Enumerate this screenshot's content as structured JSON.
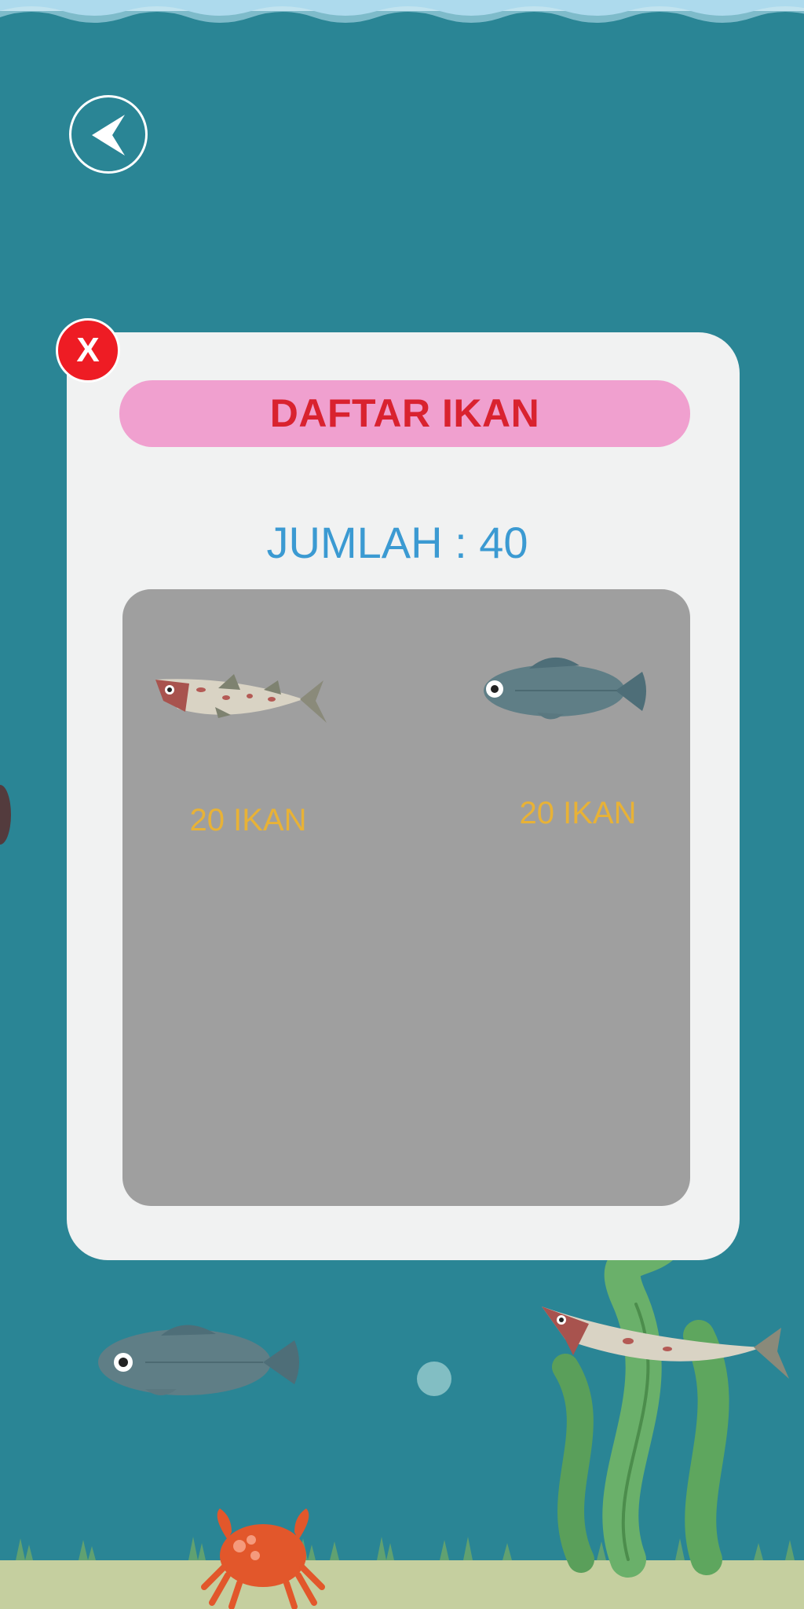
{
  "popup": {
    "close_label": "X",
    "title": "DAFTAR IKAN",
    "count_text": "JUMLAH : 40",
    "fish_list": [
      {
        "icon": "spotted-fish-icon",
        "label": "20 IKAN"
      },
      {
        "icon": "gray-fish-icon",
        "label": "20 IKAN"
      }
    ]
  },
  "colors": {
    "water": "#2a8595",
    "panel": "#f1f2f2",
    "title_bar": "#f0a0cf",
    "title_text": "#d9222f",
    "count_text": "#3b9ad2",
    "fish_box": "#9f9f9f",
    "fish_label": "#e8b236",
    "close_button": "#ee1c24",
    "sand": "#c5cf9f"
  }
}
